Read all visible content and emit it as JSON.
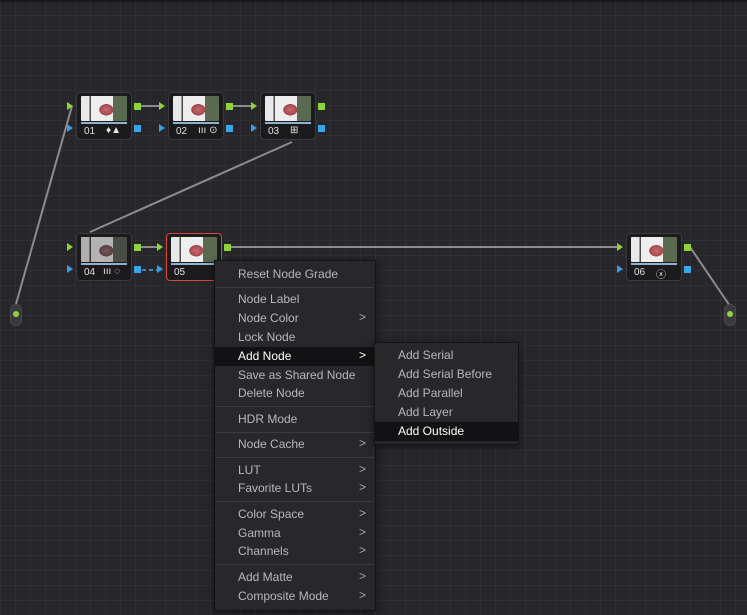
{
  "nodes": [
    {
      "id": "01",
      "label": "01",
      "icon": "♦▲",
      "icon_name": "drop-triangle-icon"
    },
    {
      "id": "02",
      "label": "02",
      "icon": "ııı ⊙",
      "icon_name": "bars-target-icon"
    },
    {
      "id": "03",
      "label": "03",
      "icon": "⊞",
      "icon_name": "grid-icon"
    },
    {
      "id": "04",
      "label": "04",
      "icon": "ııı ◌",
      "icon_name": "bars-dashed-circle-icon"
    },
    {
      "id": "05",
      "label": "05",
      "icon": "",
      "icon_name": ""
    },
    {
      "id": "06",
      "label": "06",
      "icon": "ⓧ",
      "icon_name": "fx-icon"
    }
  ],
  "context_menu": {
    "items": [
      {
        "label": "Reset Node Grade",
        "submenu": false
      },
      {
        "sep": true
      },
      {
        "label": "Node Label",
        "submenu": false
      },
      {
        "label": "Node Color",
        "submenu": true
      },
      {
        "label": "Lock Node",
        "submenu": false
      },
      {
        "label": "Add Node",
        "submenu": true,
        "active": true
      },
      {
        "label": "Save as Shared Node",
        "submenu": false
      },
      {
        "label": "Delete Node",
        "submenu": false
      },
      {
        "sep": true
      },
      {
        "label": "HDR Mode",
        "submenu": false
      },
      {
        "sep": true
      },
      {
        "label": "Node Cache",
        "submenu": true
      },
      {
        "sep": true
      },
      {
        "label": "LUT",
        "submenu": true
      },
      {
        "label": "Favorite LUTs",
        "submenu": true
      },
      {
        "sep": true
      },
      {
        "label": "Color Space",
        "submenu": true
      },
      {
        "label": "Gamma",
        "submenu": true
      },
      {
        "label": "Channels",
        "submenu": true
      },
      {
        "sep": true
      },
      {
        "label": "Add Matte",
        "submenu": true
      },
      {
        "label": "Composite Mode",
        "submenu": true
      }
    ],
    "arrow_glyph": ">"
  },
  "add_node_submenu": {
    "items": [
      {
        "label": "Add Serial"
      },
      {
        "label": "Add Serial Before"
      },
      {
        "label": "Add Parallel"
      },
      {
        "label": "Add Layer"
      },
      {
        "label": "Add Outside",
        "active": true
      }
    ]
  },
  "colors": {
    "rgb_port": "#8dd43a",
    "alpha_port": "#3aa6ea",
    "selected_border": "#d8473c",
    "wire": "#8c8c8c",
    "background": "#27272b"
  }
}
